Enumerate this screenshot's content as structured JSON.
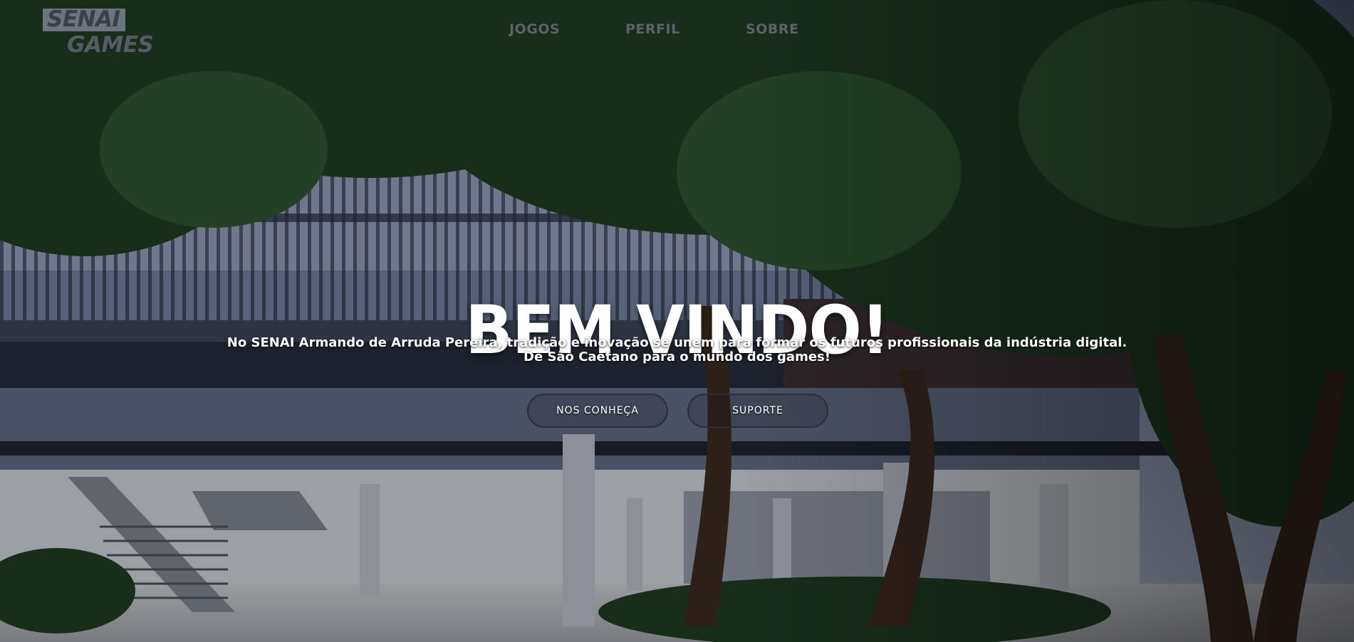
{
  "logo": {
    "line1": "SENAI",
    "line2": "GAMES"
  },
  "nav": [
    {
      "label": "JOGOS"
    },
    {
      "label": "PERFIL"
    },
    {
      "label": "SOBRE"
    }
  ],
  "hero": {
    "title": "BEM VINDO!",
    "intro_line1": "No SENAI Armando de Arruda Pereira, tradição e inovação se unem para formar os futuros profissionais da indústria digital.",
    "intro_line2": "De São Caetano para o mundo dos games!",
    "buttons": [
      {
        "label": "NOS CONHEÇA"
      },
      {
        "label": "SUPORTE"
      }
    ]
  },
  "colors": {
    "text": "#ffffff",
    "nav": "#5c616d",
    "logo_bg": "#6e7380",
    "button_border": "#2b2f38"
  }
}
